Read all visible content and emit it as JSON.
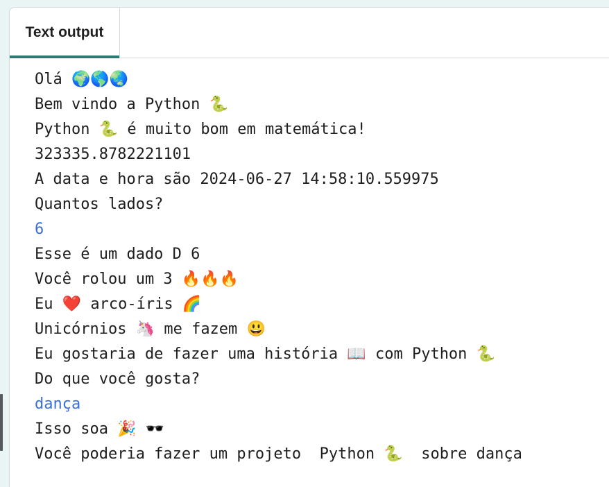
{
  "tabs": [
    {
      "label": "Text output",
      "active": true
    }
  ],
  "colors": {
    "accent": "#2e7a72",
    "input_text": "#3b6fd8",
    "output_text": "#1e1e1e"
  },
  "output_lines": [
    {
      "text": "Olá 🌍🌎🌏",
      "kind": "output"
    },
    {
      "text": "Bem vindo a Python 🐍",
      "kind": "output"
    },
    {
      "text": "Python 🐍 é muito bom em matemática!",
      "kind": "output"
    },
    {
      "text": "323335.8782221101",
      "kind": "output"
    },
    {
      "text": "A data e hora são 2024-06-27 14:58:10.559975",
      "kind": "output"
    },
    {
      "text": "Quantos lados?",
      "kind": "output"
    },
    {
      "text": "6",
      "kind": "input"
    },
    {
      "text": "Esse é um dado D 6",
      "kind": "output"
    },
    {
      "text": "Você rolou um 3 🔥🔥🔥",
      "kind": "output"
    },
    {
      "text": "Eu ❤️ arco-íris 🌈",
      "kind": "output"
    },
    {
      "text": "Unicórnios 🦄 me fazem 😃",
      "kind": "output"
    },
    {
      "text": "Eu gostaria de fazer uma história 📖 com Python 🐍",
      "kind": "output"
    },
    {
      "text": "Do que você gosta?",
      "kind": "output"
    },
    {
      "text": "dança",
      "kind": "input"
    },
    {
      "text": "Isso soa 🎉 🕶️",
      "kind": "output"
    },
    {
      "text": "Você poderia fazer um projeto  Python 🐍  sobre dança",
      "kind": "output"
    }
  ]
}
